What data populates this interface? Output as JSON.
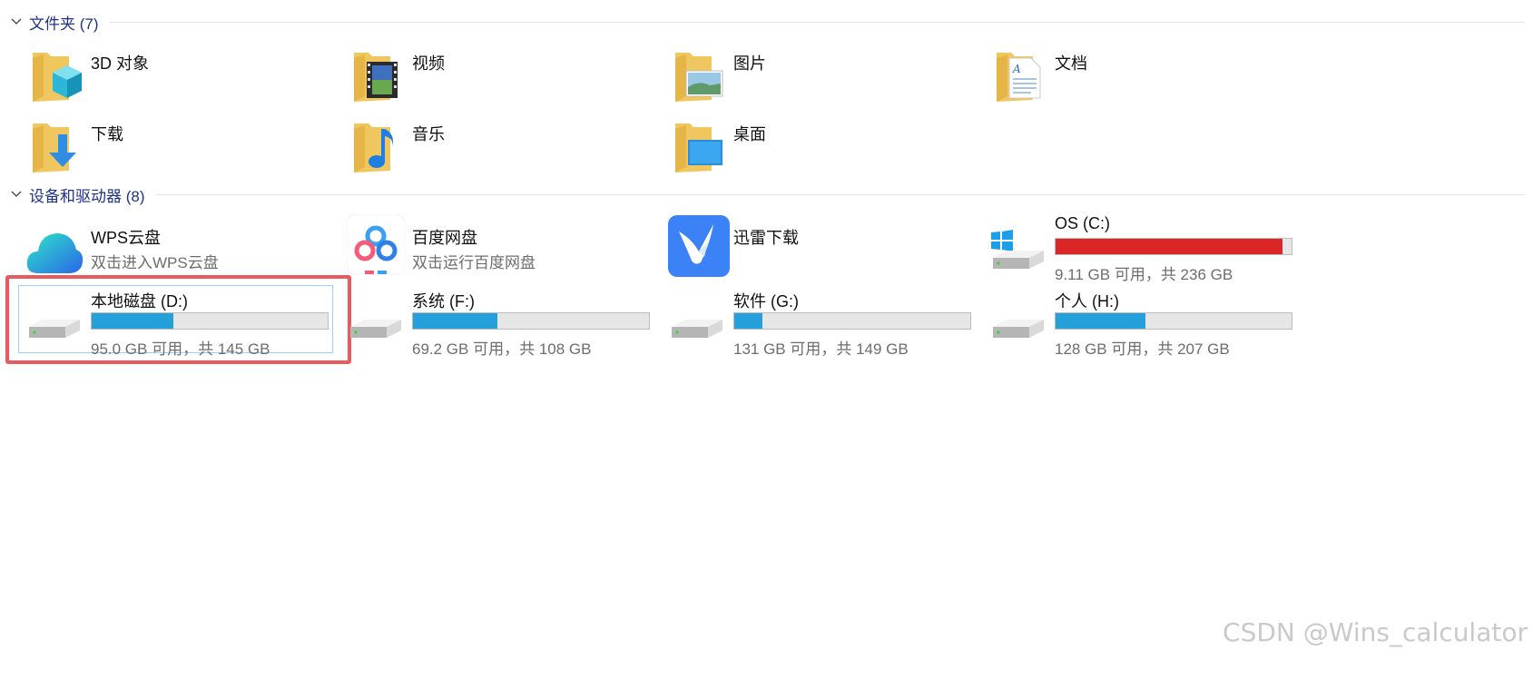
{
  "folders_section": {
    "title": "文件夹 (7)"
  },
  "folders": [
    {
      "label": "3D 对象",
      "icon": "3d-objects-folder-icon"
    },
    {
      "label": "视频",
      "icon": "videos-folder-icon"
    },
    {
      "label": "图片",
      "icon": "pictures-folder-icon"
    },
    {
      "label": "文档",
      "icon": "documents-folder-icon"
    },
    {
      "label": "下载",
      "icon": "downloads-folder-icon"
    },
    {
      "label": "音乐",
      "icon": "music-folder-icon"
    },
    {
      "label": "桌面",
      "icon": "desktop-folder-icon"
    }
  ],
  "devices_section": {
    "title": "设备和驱动器 (8)"
  },
  "apps": [
    {
      "label": "WPS云盘",
      "subtitle": "双击进入WPS云盘",
      "icon": "wps-cloud-icon"
    },
    {
      "label": "百度网盘",
      "subtitle": "双击运行百度网盘",
      "icon": "baidu-netdisk-icon"
    },
    {
      "label": "迅雷下载",
      "subtitle": "",
      "icon": "thunder-download-icon"
    }
  ],
  "drives": [
    {
      "label": "OS (C:)",
      "free_text": "9.11 GB 可用，共 236 GB",
      "used_fraction": 0.961,
      "bar_color": "#da2626",
      "icon": "windows-drive-icon"
    },
    {
      "label": "本地磁盘 (D:)",
      "free_text": "95.0 GB 可用，共 145 GB",
      "used_fraction": 0.345,
      "bar_color": "#26a0da",
      "icon": "hard-drive-icon"
    },
    {
      "label": "系统 (F:)",
      "free_text": "69.2 GB 可用，共 108 GB",
      "used_fraction": 0.359,
      "bar_color": "#26a0da",
      "icon": "hard-drive-icon"
    },
    {
      "label": "软件 (G:)",
      "free_text": "131 GB 可用，共 149 GB",
      "used_fraction": 0.121,
      "bar_color": "#26a0da",
      "icon": "hard-drive-icon"
    },
    {
      "label": "个人 (H:)",
      "free_text": "128 GB 可用，共 207 GB",
      "used_fraction": 0.382,
      "bar_color": "#26a0da",
      "icon": "hard-drive-icon"
    }
  ],
  "watermark": "CSDN @Wins_calculator"
}
